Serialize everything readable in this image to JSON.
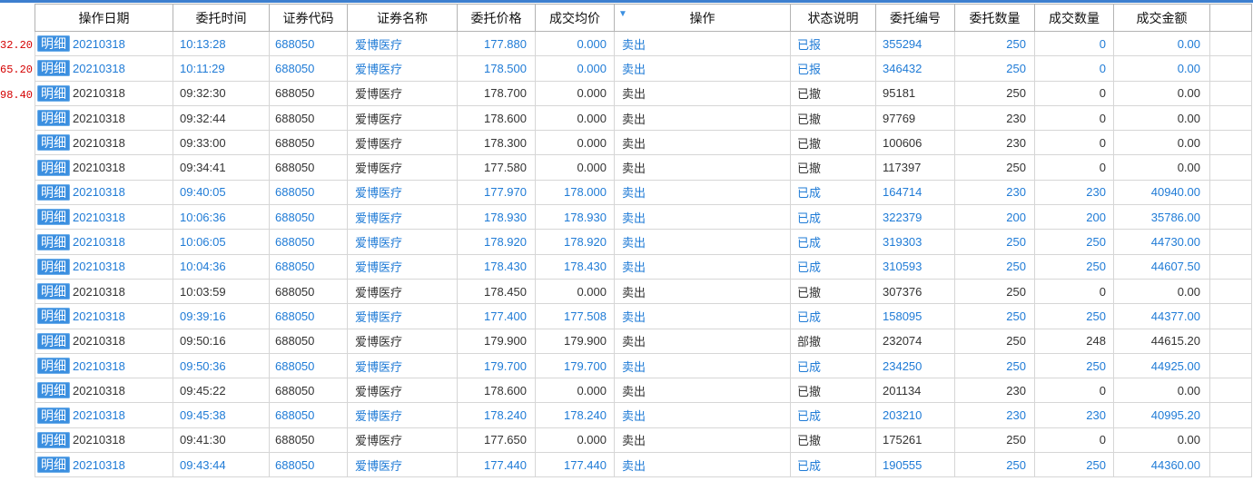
{
  "colors": {
    "accent": "#3d7fcf",
    "blue_text": "#1f7bd6",
    "normal_text": "#333333",
    "overflow_red": "#d40000",
    "badge_bg": "#3b8fe0"
  },
  "left_overflow_values": [
    "32.20",
    "65.20",
    "98.40"
  ],
  "columns": [
    "操作日期",
    "委托时间",
    "证券代码",
    "证券名称",
    "委托价格",
    "成交均价",
    "操作",
    "状态说明",
    "委托编号",
    "委托数量",
    "成交数量",
    "成交金额"
  ],
  "sort_icon": "sort-desc-icon",
  "detail_label": "明细",
  "rows": [
    {
      "date": "20210318",
      "time": "10:13:28",
      "code": "688050",
      "name": "爱博医疗",
      "price": "177.880",
      "avg_price": "0.000",
      "action": "卖出",
      "status": "已报",
      "order_no": "355294",
      "qty": "250",
      "filled_qty": "0",
      "amount": "0.00",
      "text_color": "#1f7bd6"
    },
    {
      "date": "20210318",
      "time": "10:11:29",
      "code": "688050",
      "name": "爱博医疗",
      "price": "178.500",
      "avg_price": "0.000",
      "action": "卖出",
      "status": "已报",
      "order_no": "346432",
      "qty": "250",
      "filled_qty": "0",
      "amount": "0.00",
      "text_color": "#1f7bd6"
    },
    {
      "date": "20210318",
      "time": "09:32:30",
      "code": "688050",
      "name": "爱博医疗",
      "price": "178.700",
      "avg_price": "0.000",
      "action": "卖出",
      "status": "已撤",
      "order_no": "95181",
      "qty": "250",
      "filled_qty": "0",
      "amount": "0.00",
      "text_color": "#333333"
    },
    {
      "date": "20210318",
      "time": "09:32:44",
      "code": "688050",
      "name": "爱博医疗",
      "price": "178.600",
      "avg_price": "0.000",
      "action": "卖出",
      "status": "已撤",
      "order_no": "97769",
      "qty": "230",
      "filled_qty": "0",
      "amount": "0.00",
      "text_color": "#333333"
    },
    {
      "date": "20210318",
      "time": "09:33:00",
      "code": "688050",
      "name": "爱博医疗",
      "price": "178.300",
      "avg_price": "0.000",
      "action": "卖出",
      "status": "已撤",
      "order_no": "100606",
      "qty": "230",
      "filled_qty": "0",
      "amount": "0.00",
      "text_color": "#333333"
    },
    {
      "date": "20210318",
      "time": "09:34:41",
      "code": "688050",
      "name": "爱博医疗",
      "price": "177.580",
      "avg_price": "0.000",
      "action": "卖出",
      "status": "已撤",
      "order_no": "117397",
      "qty": "250",
      "filled_qty": "0",
      "amount": "0.00",
      "text_color": "#333333"
    },
    {
      "date": "20210318",
      "time": "09:40:05",
      "code": "688050",
      "name": "爱博医疗",
      "price": "177.970",
      "avg_price": "178.000",
      "action": "卖出",
      "status": "已成",
      "order_no": "164714",
      "qty": "230",
      "filled_qty": "230",
      "amount": "40940.00",
      "text_color": "#1f7bd6"
    },
    {
      "date": "20210318",
      "time": "10:06:36",
      "code": "688050",
      "name": "爱博医疗",
      "price": "178.930",
      "avg_price": "178.930",
      "action": "卖出",
      "status": "已成",
      "order_no": "322379",
      "qty": "200",
      "filled_qty": "200",
      "amount": "35786.00",
      "text_color": "#1f7bd6"
    },
    {
      "date": "20210318",
      "time": "10:06:05",
      "code": "688050",
      "name": "爱博医疗",
      "price": "178.920",
      "avg_price": "178.920",
      "action": "卖出",
      "status": "已成",
      "order_no": "319303",
      "qty": "250",
      "filled_qty": "250",
      "amount": "44730.00",
      "text_color": "#1f7bd6"
    },
    {
      "date": "20210318",
      "time": "10:04:36",
      "code": "688050",
      "name": "爱博医疗",
      "price": "178.430",
      "avg_price": "178.430",
      "action": "卖出",
      "status": "已成",
      "order_no": "310593",
      "qty": "250",
      "filled_qty": "250",
      "amount": "44607.50",
      "text_color": "#1f7bd6"
    },
    {
      "date": "20210318",
      "time": "10:03:59",
      "code": "688050",
      "name": "爱博医疗",
      "price": "178.450",
      "avg_price": "0.000",
      "action": "卖出",
      "status": "已撤",
      "order_no": "307376",
      "qty": "250",
      "filled_qty": "0",
      "amount": "0.00",
      "text_color": "#333333"
    },
    {
      "date": "20210318",
      "time": "09:39:16",
      "code": "688050",
      "name": "爱博医疗",
      "price": "177.400",
      "avg_price": "177.508",
      "action": "卖出",
      "status": "已成",
      "order_no": "158095",
      "qty": "250",
      "filled_qty": "250",
      "amount": "44377.00",
      "text_color": "#1f7bd6"
    },
    {
      "date": "20210318",
      "time": "09:50:16",
      "code": "688050",
      "name": "爱博医疗",
      "price": "179.900",
      "avg_price": "179.900",
      "action": "卖出",
      "status": "部撤",
      "order_no": "232074",
      "qty": "250",
      "filled_qty": "248",
      "amount": "44615.20",
      "text_color": "#333333"
    },
    {
      "date": "20210318",
      "time": "09:50:36",
      "code": "688050",
      "name": "爱博医疗",
      "price": "179.700",
      "avg_price": "179.700",
      "action": "卖出",
      "status": "已成",
      "order_no": "234250",
      "qty": "250",
      "filled_qty": "250",
      "amount": "44925.00",
      "text_color": "#1f7bd6"
    },
    {
      "date": "20210318",
      "time": "09:45:22",
      "code": "688050",
      "name": "爱博医疗",
      "price": "178.600",
      "avg_price": "0.000",
      "action": "卖出",
      "status": "已撤",
      "order_no": "201134",
      "qty": "230",
      "filled_qty": "0",
      "amount": "0.00",
      "text_color": "#333333"
    },
    {
      "date": "20210318",
      "time": "09:45:38",
      "code": "688050",
      "name": "爱博医疗",
      "price": "178.240",
      "avg_price": "178.240",
      "action": "卖出",
      "status": "已成",
      "order_no": "203210",
      "qty": "230",
      "filled_qty": "230",
      "amount": "40995.20",
      "text_color": "#1f7bd6"
    },
    {
      "date": "20210318",
      "time": "09:41:30",
      "code": "688050",
      "name": "爱博医疗",
      "price": "177.650",
      "avg_price": "0.000",
      "action": "卖出",
      "status": "已撤",
      "order_no": "175261",
      "qty": "250",
      "filled_qty": "0",
      "amount": "0.00",
      "text_color": "#333333"
    },
    {
      "date": "20210318",
      "time": "09:43:44",
      "code": "688050",
      "name": "爱博医疗",
      "price": "177.440",
      "avg_price": "177.440",
      "action": "卖出",
      "status": "已成",
      "order_no": "190555",
      "qty": "250",
      "filled_qty": "250",
      "amount": "44360.00",
      "text_color": "#1f7bd6"
    }
  ]
}
